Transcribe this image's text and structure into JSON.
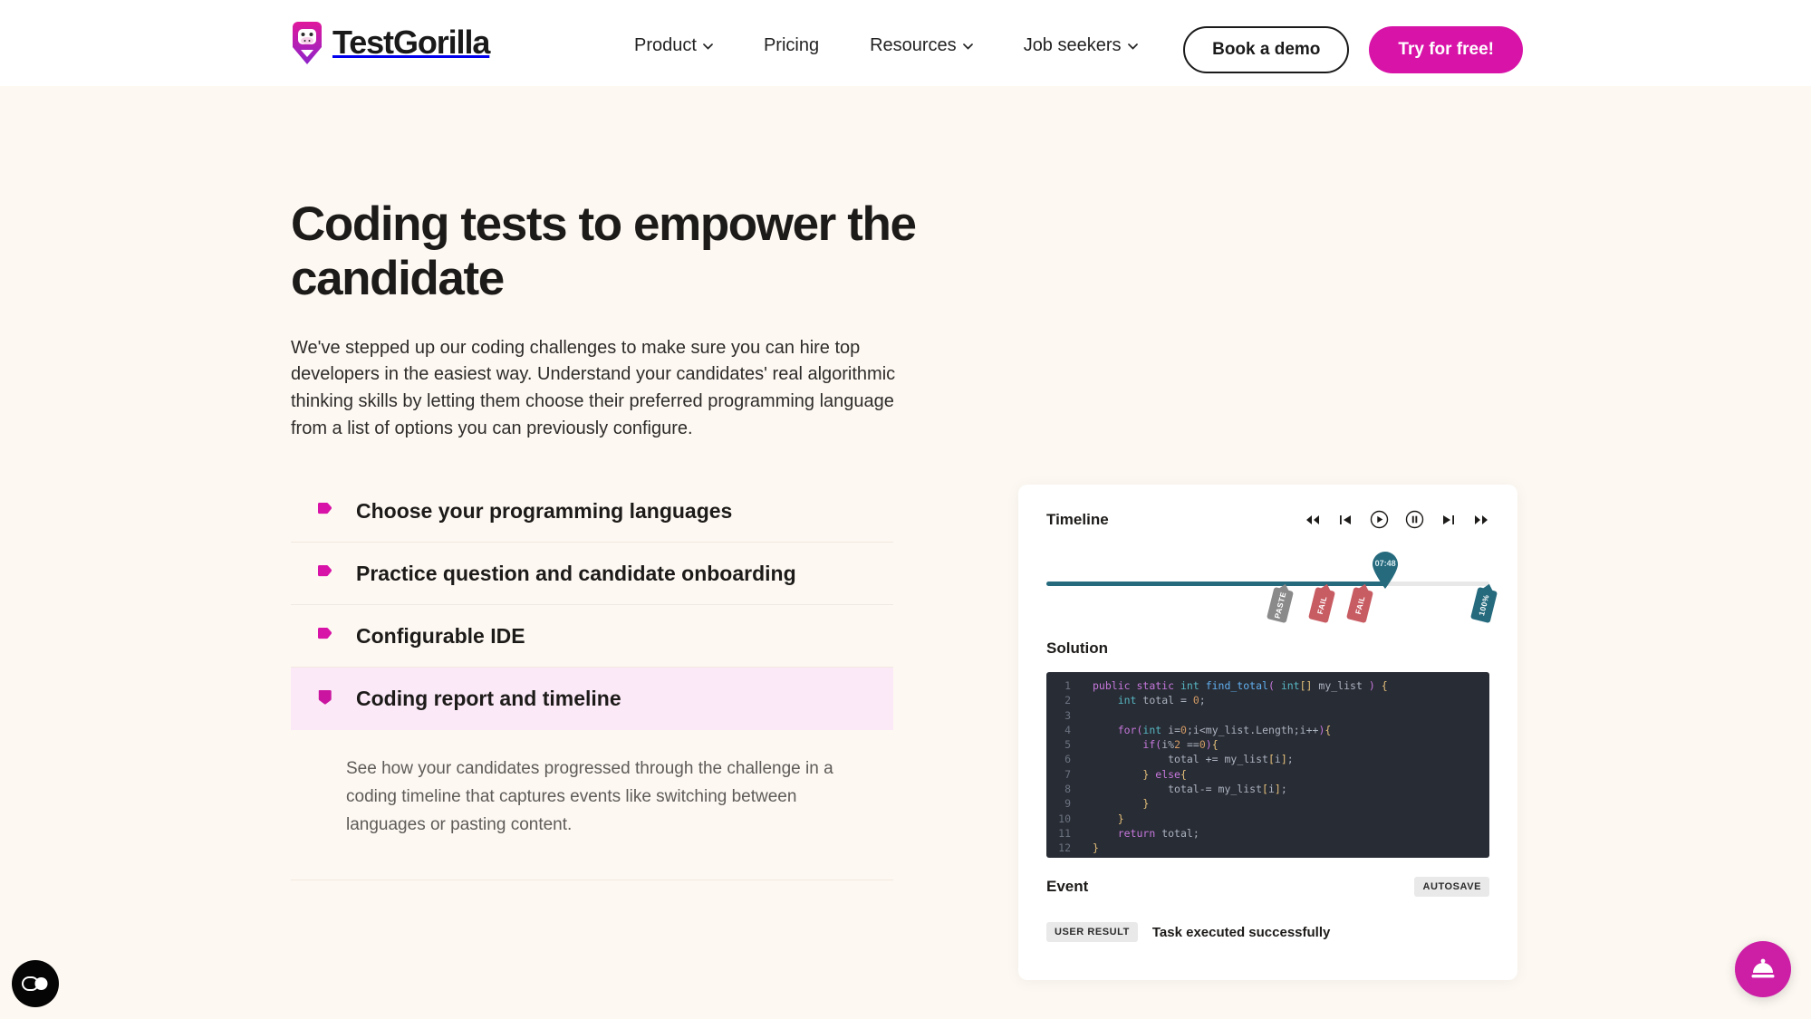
{
  "brand": {
    "name": "TestGorilla",
    "logo_icon": "gorilla-logo-icon",
    "accent_pink": "#d813a8",
    "page_background": "#fdf8f2"
  },
  "nav": {
    "items": [
      {
        "label": "Product",
        "has_dropdown": true,
        "icon": "chevron-down-icon"
      },
      {
        "label": "Pricing",
        "has_dropdown": false
      },
      {
        "label": "Resources",
        "has_dropdown": true,
        "icon": "chevron-down-icon"
      },
      {
        "label": "Job seekers",
        "has_dropdown": true,
        "icon": "chevron-down-icon"
      }
    ],
    "demo_button": "Book a demo",
    "try_button": "Try for free!"
  },
  "hero": {
    "title": "Coding tests to empower the candidate",
    "paragraph": "We've stepped up our coding challenges to make sure you can hire top developers in the easiest way. Understand your candidates' real algorithmic thinking skills by letting them choose their preferred programming language from a list of options you can previously configure."
  },
  "accordion": {
    "items": [
      {
        "label": "Choose your programming languages",
        "active": false,
        "bullet_icon": "pentagon-right-bullet-icon"
      },
      {
        "label": "Practice question and candidate onboarding",
        "active": false,
        "bullet_icon": "pentagon-right-bullet-icon"
      },
      {
        "label": "Configurable IDE",
        "active": false,
        "bullet_icon": "pentagon-right-bullet-icon"
      },
      {
        "label": "Coding report and timeline",
        "active": true,
        "bullet_icon": "pentagon-down-bullet-icon"
      }
    ],
    "active_index": 3,
    "active_panel_text": "See how your candidates progressed through the challenge in a coding timeline that captures events like switching between languages or pasting content.",
    "active_background": "#fbe9f7"
  },
  "report_card": {
    "timeline": {
      "title": "Timeline",
      "controls": [
        {
          "name": "rewind-button",
          "icon": "rewind-icon"
        },
        {
          "name": "skip-back-button",
          "icon": "skip-back-icon"
        },
        {
          "name": "play-button",
          "icon": "play-circle-icon"
        },
        {
          "name": "pause-button",
          "icon": "pause-circle-icon"
        },
        {
          "name": "skip-forward-button",
          "icon": "skip-forward-icon"
        },
        {
          "name": "fast-forward-button",
          "icon": "fast-forward-icon"
        }
      ],
      "playhead_time": "07:48",
      "playhead_percent": 76.5,
      "progress_color": "#256a7d",
      "track_color": "#e8e8e8",
      "markers": [
        {
          "label": "PASTE",
          "type": "paste",
          "color": "#8a8a8a",
          "position_percent": 50.5
        },
        {
          "label": "FAIL",
          "type": "fail",
          "color": "#c85c63",
          "position_percent": 60.0
        },
        {
          "label": "FAIL",
          "type": "fail",
          "color": "#c85c63",
          "position_percent": 68.5
        },
        {
          "label": "100%",
          "type": "score",
          "color": "#256a7d",
          "position_percent": 96.5
        }
      ]
    },
    "solution": {
      "title": "Solution",
      "editor_background": "#282c34",
      "line_numbers": [
        "1",
        "2",
        "3",
        "4",
        "5",
        "6",
        "7",
        "8",
        "9",
        "10",
        "11",
        "12"
      ],
      "code_lines": [
        "public static int find_total( int[] my_list ) {",
        "    int total = 0;",
        "",
        "    for(int i=0;i<my_list.Length;i++){",
        "        if(i%2 ==0){",
        "            total += my_list[i];",
        "        } else{",
        "            total-= my_list[i];",
        "        }",
        "    }",
        "    return total;",
        "}"
      ]
    },
    "event": {
      "title": "Event",
      "autosave_badge": "AUTOSAVE",
      "result_badge": "USER RESULT",
      "result_text": "Task executed successfully"
    }
  },
  "floating": {
    "cookie_widget": {
      "name": "cookie-consent-button",
      "icon": "cookie-toggle-icon"
    },
    "help_widget": {
      "name": "support-bell-button",
      "icon": "service-bell-icon",
      "color": "#cc1fa6"
    }
  }
}
